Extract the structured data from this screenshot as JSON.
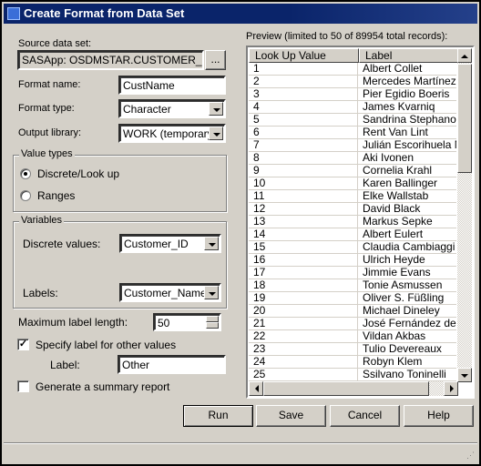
{
  "window": {
    "title": "Create Format from Data Set"
  },
  "form": {
    "source_label": "Source data set:",
    "source_value": "SASApp: OSDMSTAR.CUSTOMER_DIM",
    "browse_label": "...",
    "format_name_label": "Format name:",
    "format_name_value": "CustName",
    "format_type_label": "Format type:",
    "format_type_value": "Character",
    "output_library_label": "Output library:",
    "output_library_value": "WORK (temporary)",
    "value_types_title": "Value types",
    "discrete_label": "Discrete/Look up",
    "ranges_label": "Ranges",
    "value_type_selected": "Discrete/Look up",
    "variables_title": "Variables",
    "discrete_values_label": "Discrete values:",
    "discrete_values_value": "Customer_ID",
    "labels_label": "Labels:",
    "labels_value": "Customer_Name",
    "max_label_length_label": "Maximum label length:",
    "max_label_length_value": "50",
    "specify_other_label": "Specify label for other values",
    "specify_other_checked": true,
    "other_label_label": "Label:",
    "other_label_value": "Other",
    "summary_report_label": "Generate a summary report",
    "summary_report_checked": false
  },
  "preview": {
    "title": "Preview (limited to 50 of 89954 total records):",
    "columns": [
      "Look Up Value",
      "Label"
    ],
    "rows": [
      [
        "1",
        "Albert Collet"
      ],
      [
        "2",
        "Mercedes Martínez"
      ],
      [
        "3",
        "Pier Egidio Boeris"
      ],
      [
        "4",
        "James Kvarniq"
      ],
      [
        "5",
        "Sandrina Stephano"
      ],
      [
        "6",
        "Rent Van Lint"
      ],
      [
        "7",
        "Julián Escorihuela M."
      ],
      [
        "8",
        "Aki Ivonen"
      ],
      [
        "9",
        "Cornelia Krahl"
      ],
      [
        "10",
        "Karen Ballinger"
      ],
      [
        "11",
        "Elke Wallstab"
      ],
      [
        "12",
        "David Black"
      ],
      [
        "13",
        "Markus Sepke"
      ],
      [
        "14",
        "Albert Eulert"
      ],
      [
        "15",
        "Claudia Cambiaggi"
      ],
      [
        "16",
        "Ulrich Heyde"
      ],
      [
        "17",
        "Jimmie Evans"
      ],
      [
        "18",
        "Tonie Asmussen"
      ],
      [
        "19",
        "Oliver S. Füßling"
      ],
      [
        "20",
        "Michael Dineley"
      ],
      [
        "21",
        "José Fernández de M"
      ],
      [
        "22",
        "Vildan Akbas"
      ],
      [
        "23",
        "Tulio Devereaux"
      ],
      [
        "24",
        "Robyn Klem"
      ],
      [
        "25",
        "Ssilvano Toninelli"
      ]
    ]
  },
  "buttons": {
    "run": "Run",
    "save": "Save",
    "cancel": "Cancel",
    "help": "Help"
  },
  "colors": {
    "titlebar": "#0a246a",
    "face": "#d4d0c8"
  }
}
